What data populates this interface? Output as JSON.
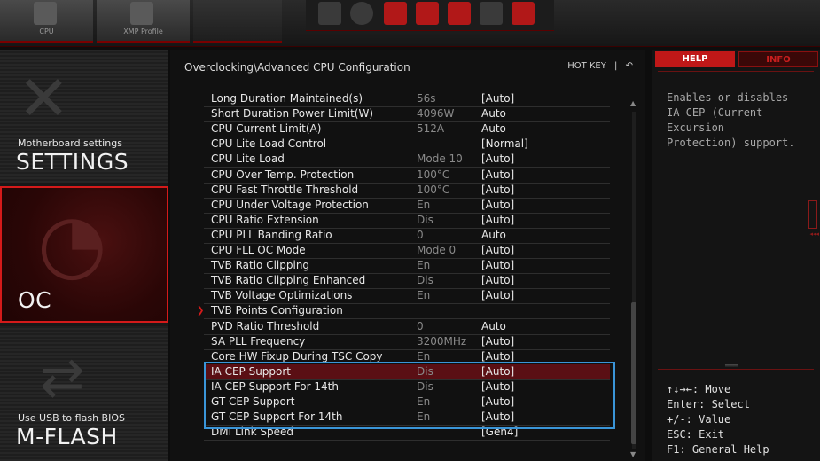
{
  "topbar": {
    "buttons": [
      {
        "label": "CPU"
      },
      {
        "label": "XMP Profile"
      }
    ]
  },
  "nav": {
    "settings": {
      "sub": "Motherboard settings",
      "title": "SETTINGS"
    },
    "oc": {
      "title": "OC"
    },
    "mflash": {
      "sub": "Use USB to flash BIOS",
      "title": "M-FLASH"
    }
  },
  "main": {
    "breadcrumb": "Overclocking\\Advanced CPU Configuration",
    "hotkey_label": "HOT KEY",
    "hotkey_sep": "|",
    "back_icon": "↶",
    "rows": [
      {
        "label": "Long Duration Maintained(s)",
        "current": "56s",
        "value": "[Auto]"
      },
      {
        "label": "Short Duration Power Limit(W)",
        "current": "4096W",
        "value": "Auto"
      },
      {
        "label": "CPU Current Limit(A)",
        "current": "512A",
        "value": "Auto"
      },
      {
        "label": "CPU Lite Load Control",
        "current": "",
        "value": "[Normal]"
      },
      {
        "label": "CPU Lite Load",
        "current": "Mode 10",
        "value": "[Auto]"
      },
      {
        "label": "CPU Over Temp. Protection",
        "current": "100°C",
        "value": "[Auto]"
      },
      {
        "label": "CPU Fast Throttle Threshold",
        "current": "100°C",
        "value": "[Auto]"
      },
      {
        "label": "CPU Under Voltage Protection",
        "current": "En",
        "value": "[Auto]"
      },
      {
        "label": "CPU Ratio Extension",
        "current": "Dis",
        "value": "[Auto]"
      },
      {
        "label": "CPU PLL Banding Ratio",
        "current": "0",
        "value": "Auto"
      },
      {
        "label": "CPU FLL OC Mode",
        "current": "Mode 0",
        "value": "[Auto]"
      },
      {
        "label": "TVB Ratio Clipping",
        "current": "En",
        "value": "[Auto]"
      },
      {
        "label": "TVB Ratio Clipping Enhanced",
        "current": "Dis",
        "value": "[Auto]"
      },
      {
        "label": "TVB Voltage Optimizations",
        "current": "En",
        "value": "[Auto]"
      },
      {
        "label": "TVB Points Configuration",
        "current": "",
        "value": ""
      },
      {
        "label": "PVD Ratio Threshold",
        "current": "0",
        "value": "Auto"
      },
      {
        "label": "SA PLL Frequency",
        "current": "3200MHz",
        "value": "[Auto]"
      },
      {
        "label": "Core HW Fixup During TSC Copy",
        "current": "En",
        "value": "[Auto]"
      },
      {
        "label": "IA CEP Support",
        "current": "Dis",
        "value": "[Auto]"
      },
      {
        "label": "IA CEP Support For 14th",
        "current": "Dis",
        "value": "[Auto]"
      },
      {
        "label": "GT CEP Support",
        "current": "En",
        "value": "[Auto]"
      },
      {
        "label": "GT CEP Support For 14th",
        "current": "En",
        "value": "[Auto]"
      },
      {
        "label": "DMI Link Speed",
        "current": "",
        "value": "[Gen4]"
      }
    ],
    "submenu_arrow": "❯"
  },
  "help": {
    "tab_help": "HELP",
    "tab_info": "INFO",
    "text": "Enables or disables\nIA CEP (Current\nExcursion\nProtection) support.",
    "keys": [
      "↑↓→←: Move",
      "Enter: Select",
      "+/-: Value",
      "ESC: Exit",
      "F1: General Help"
    ]
  },
  "accent_colors": {
    "red": "#d41a1a",
    "highlight_box": "#3a95d8",
    "selected_row": "#5a0f14"
  }
}
